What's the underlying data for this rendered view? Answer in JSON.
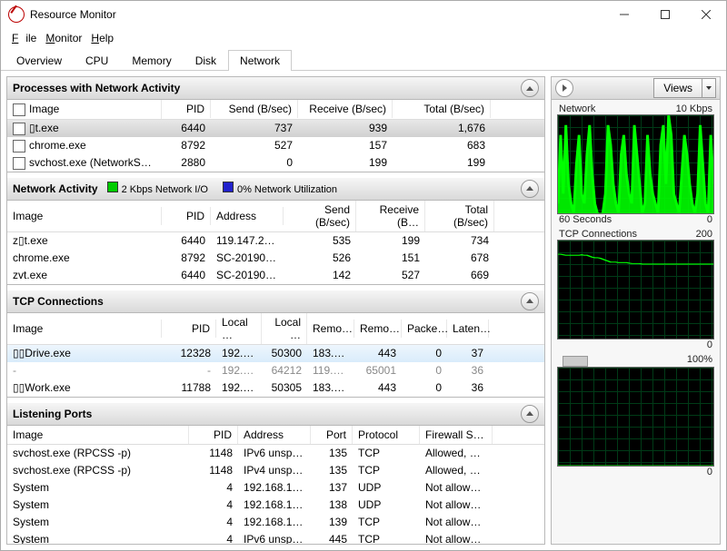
{
  "title": "Resource Monitor",
  "menu": {
    "file": "File",
    "monitor": "Monitor",
    "help": "Help"
  },
  "tabs": {
    "overview": "Overview",
    "cpu": "CPU",
    "memory": "Memory",
    "disk": "Disk",
    "network": "Network"
  },
  "panels": {
    "proc": {
      "title": "Processes with Network Activity",
      "cols": {
        "image": "Image",
        "pid": "PID",
        "send": "Send (B/sec)",
        "recv": "Receive (B/sec)",
        "total": "Total (B/sec)"
      },
      "rows": [
        {
          "image": "▯t.exe",
          "pid": "6440",
          "send": "737",
          "recv": "939",
          "total": "1,676"
        },
        {
          "image": "chrome.exe",
          "pid": "8792",
          "send": "527",
          "recv": "157",
          "total": "683"
        },
        {
          "image": "svchost.exe (NetworkService…",
          "pid": "2880",
          "send": "0",
          "recv": "199",
          "total": "199"
        }
      ]
    },
    "act": {
      "title": "Network Activity",
      "ind1": "2 Kbps Network I/O",
      "ind2": "0% Network Utilization",
      "cols": {
        "image": "Image",
        "pid": "PID",
        "addr": "Address",
        "send": "Send (B/sec)",
        "recv": "Receive (B…",
        "total": "Total (B/sec)"
      },
      "rows": [
        {
          "image": "z▯t.exe",
          "pid": "6440",
          "addr": "119.147.2…",
          "send": "535",
          "recv": "199",
          "total": "734"
        },
        {
          "image": "chrome.exe",
          "pid": "8792",
          "addr": "SC-20190…",
          "send": "526",
          "recv": "151",
          "total": "678"
        },
        {
          "image": "zvt.exe",
          "pid": "6440",
          "addr": "SC-20190…",
          "send": "142",
          "recv": "527",
          "total": "669"
        }
      ]
    },
    "tcp": {
      "title": "TCP Connections",
      "cols": {
        "image": "Image",
        "pid": "PID",
        "laddr": "Local …",
        "lport": "Local …",
        "raddr": "Remo…",
        "rport": "Remo…",
        "loss": "Packe…",
        "lat": "Laten…"
      },
      "rows": [
        {
          "image": "▯▯Drive.exe",
          "pid": "12328",
          "laddr": "192.1…",
          "lport": "50300",
          "raddr": "183.4…",
          "rport": "443",
          "loss": "0",
          "lat": "37",
          "sel": true
        },
        {
          "image": "-",
          "pid": "-",
          "laddr": "192.1…",
          "lport": "64212",
          "raddr": "119.1…",
          "rport": "65001",
          "loss": "0",
          "lat": "36",
          "gray": true
        },
        {
          "image": "▯▯Work.exe",
          "pid": "11788",
          "laddr": "192.1…",
          "lport": "50305",
          "raddr": "183.4…",
          "rport": "443",
          "loss": "0",
          "lat": "36"
        }
      ]
    },
    "ports": {
      "title": "Listening Ports",
      "cols": {
        "image": "Image",
        "pid": "PID",
        "addr": "Address",
        "port": "Port",
        "proto": "Protocol",
        "fw": "Firewall S…"
      },
      "rows": [
        {
          "image": "svchost.exe (RPCSS -p)",
          "pid": "1148",
          "addr": "IPv6 unsp…",
          "port": "135",
          "proto": "TCP",
          "fw": "Allowed, …"
        },
        {
          "image": "svchost.exe (RPCSS -p)",
          "pid": "1148",
          "addr": "IPv4 unsp…",
          "port": "135",
          "proto": "TCP",
          "fw": "Allowed, …"
        },
        {
          "image": "System",
          "pid": "4",
          "addr": "192.168.1…",
          "port": "137",
          "proto": "UDP",
          "fw": "Not allow…"
        },
        {
          "image": "System",
          "pid": "4",
          "addr": "192.168.1…",
          "port": "138",
          "proto": "UDP",
          "fw": "Not allow…"
        },
        {
          "image": "System",
          "pid": "4",
          "addr": "192.168.1…",
          "port": "139",
          "proto": "TCP",
          "fw": "Not allow…"
        },
        {
          "image": "System",
          "pid": "4",
          "addr": "IPv6 unsp…",
          "port": "445",
          "proto": "TCP",
          "fw": "Not allow…"
        }
      ]
    }
  },
  "right": {
    "views": "Views",
    "charts": [
      {
        "name": "Network",
        "right": "10 Kbps",
        "bl": "60 Seconds",
        "br": "0"
      },
      {
        "name": "TCP Connections",
        "right": "200",
        "bl": "",
        "br": "0"
      },
      {
        "name": "",
        "right": "100%",
        "bl": "",
        "br": "0"
      }
    ]
  },
  "chart_data": [
    {
      "type": "area",
      "title": "Network",
      "ylabel": "Kbps",
      "ylim": [
        0,
        10
      ],
      "xsec": 60,
      "values": [
        1,
        8,
        2,
        9,
        3,
        1,
        0,
        5,
        8,
        2,
        1,
        6,
        9,
        4,
        1,
        0,
        0,
        0,
        2,
        9,
        7,
        3,
        1,
        0,
        6,
        8,
        4,
        2,
        1,
        9,
        6,
        3,
        0,
        1,
        8,
        4,
        2,
        1,
        0,
        7,
        9,
        3,
        10,
        8,
        2,
        1,
        0,
        4,
        8,
        6,
        3,
        1,
        0,
        2,
        9,
        5,
        1,
        0,
        8,
        3
      ]
    },
    {
      "type": "line",
      "title": "TCP Connections",
      "ylim": [
        0,
        200
      ],
      "xsec": 60,
      "values": [
        172,
        172,
        171,
        170,
        170,
        170,
        170,
        170,
        170,
        171,
        170,
        170,
        168,
        166,
        165,
        165,
        164,
        162,
        160,
        158,
        156,
        156,
        156,
        155,
        155,
        155,
        155,
        154,
        153,
        153,
        153,
        153,
        152,
        152,
        152,
        152,
        152,
        152,
        152,
        152,
        152,
        152,
        152,
        152,
        152,
        152,
        152,
        152,
        152,
        152,
        152,
        152,
        152,
        152,
        152,
        152,
        152,
        152,
        152,
        152
      ]
    },
    {
      "type": "line",
      "title": "Utilization",
      "ylabel": "%",
      "ylim": [
        0,
        100
      ],
      "xsec": 60,
      "values": [
        0,
        0,
        0,
        0,
        0,
        0,
        0,
        0,
        0,
        0,
        0,
        0,
        0,
        0,
        0,
        0,
        0,
        0,
        0,
        0,
        0,
        0,
        0,
        0,
        0,
        0,
        0,
        0,
        0,
        0,
        0,
        0,
        0,
        0,
        0,
        0,
        0,
        0,
        0,
        0,
        0,
        0,
        0,
        0,
        0,
        0,
        0,
        0,
        0,
        0,
        0,
        0,
        0,
        0,
        0,
        0,
        0,
        0,
        0,
        0
      ]
    }
  ]
}
